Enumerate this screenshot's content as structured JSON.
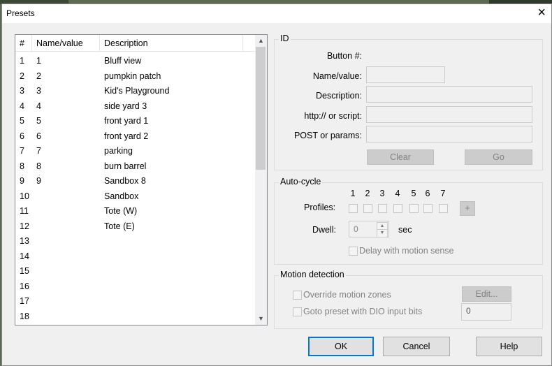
{
  "window": {
    "title": "Presets",
    "close_icon": "×"
  },
  "list": {
    "headers": [
      "#",
      "Name/value",
      "Description"
    ],
    "rows": [
      {
        "num": "1",
        "name": "1",
        "desc": "Bluff view"
      },
      {
        "num": "2",
        "name": "2",
        "desc": "pumpkin patch"
      },
      {
        "num": "3",
        "name": "3",
        "desc": "Kid's Playground"
      },
      {
        "num": "4",
        "name": "4",
        "desc": "side yard 3"
      },
      {
        "num": "5",
        "name": "5",
        "desc": "front yard 1"
      },
      {
        "num": "6",
        "name": "6",
        "desc": "front yard 2"
      },
      {
        "num": "7",
        "name": "7",
        "desc": "parking"
      },
      {
        "num": "8",
        "name": "8",
        "desc": "burn barrel"
      },
      {
        "num": "9",
        "name": "9",
        "desc": "Sandbox 8"
      },
      {
        "num": "10",
        "name": "",
        "desc": "Sandbox"
      },
      {
        "num": "11",
        "name": "",
        "desc": "Tote (W)"
      },
      {
        "num": "12",
        "name": "",
        "desc": "Tote (E)"
      },
      {
        "num": "13",
        "name": "",
        "desc": ""
      },
      {
        "num": "14",
        "name": "",
        "desc": ""
      },
      {
        "num": "15",
        "name": "",
        "desc": ""
      },
      {
        "num": "16",
        "name": "",
        "desc": ""
      },
      {
        "num": "17",
        "name": "",
        "desc": ""
      },
      {
        "num": "18",
        "name": "",
        "desc": ""
      }
    ]
  },
  "id_group": {
    "legend": "ID",
    "button_label": "Button #:",
    "name_label": "Name/value:",
    "name_value": "",
    "desc_label": "Description:",
    "desc_value": "",
    "http_label": "http:// or script:",
    "http_value": "",
    "post_label": "POST or params:",
    "post_value": "",
    "clear_label": "Clear",
    "go_label": "Go"
  },
  "autocycle": {
    "legend": "Auto-cycle",
    "profile_numbers": [
      "1",
      "2",
      "3",
      "4",
      "5",
      "6",
      "7"
    ],
    "profiles_label": "Profiles:",
    "add_label": "+",
    "dwell_label": "Dwell:",
    "dwell_value": "0",
    "dwell_unit": "sec",
    "delay_label": "Delay with motion sense"
  },
  "motion": {
    "legend": "Motion detection",
    "override_label": "Override motion zones",
    "edit_label": "Edit...",
    "goto_label": "Goto preset with DIO input bits",
    "dio_value": "0"
  },
  "footer": {
    "ok_label": "OK",
    "cancel_label": "Cancel",
    "help_label": "Help"
  }
}
